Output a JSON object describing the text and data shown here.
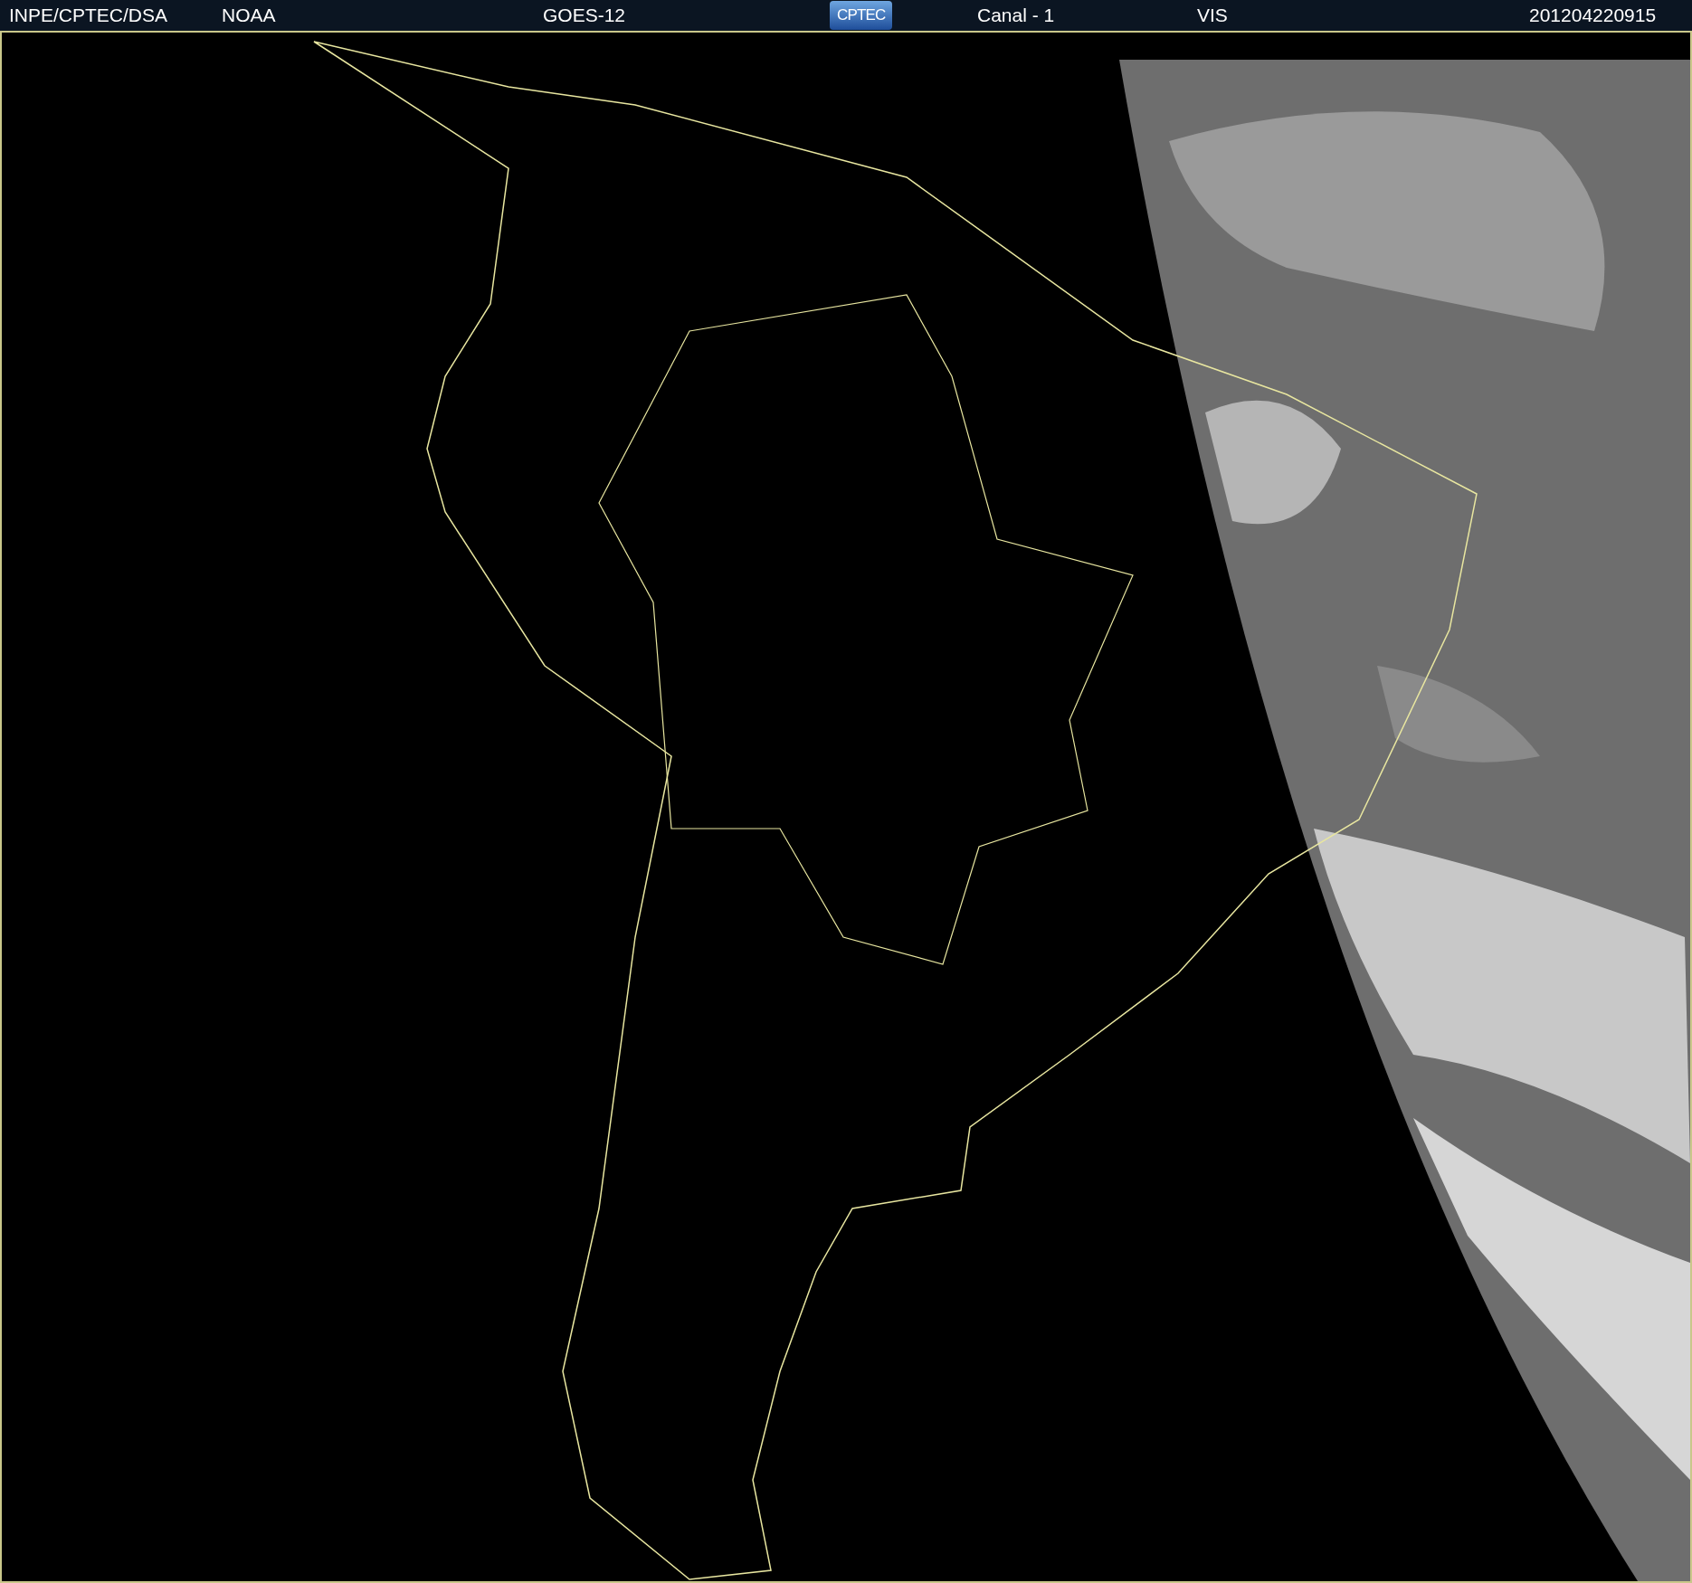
{
  "header": {
    "items": [
      {
        "kind": "text",
        "text": "INPE/CPTEC/DSA"
      },
      {
        "kind": "text",
        "text": "NOAA"
      },
      {
        "kind": "text",
        "text": "GOES-12"
      },
      {
        "kind": "logo",
        "text": "CPTEC"
      },
      {
        "kind": "text",
        "text": "Canal - 1"
      },
      {
        "kind": "text",
        "text": "VIS"
      },
      {
        "kind": "text",
        "text": "201204220915"
      }
    ]
  }
}
